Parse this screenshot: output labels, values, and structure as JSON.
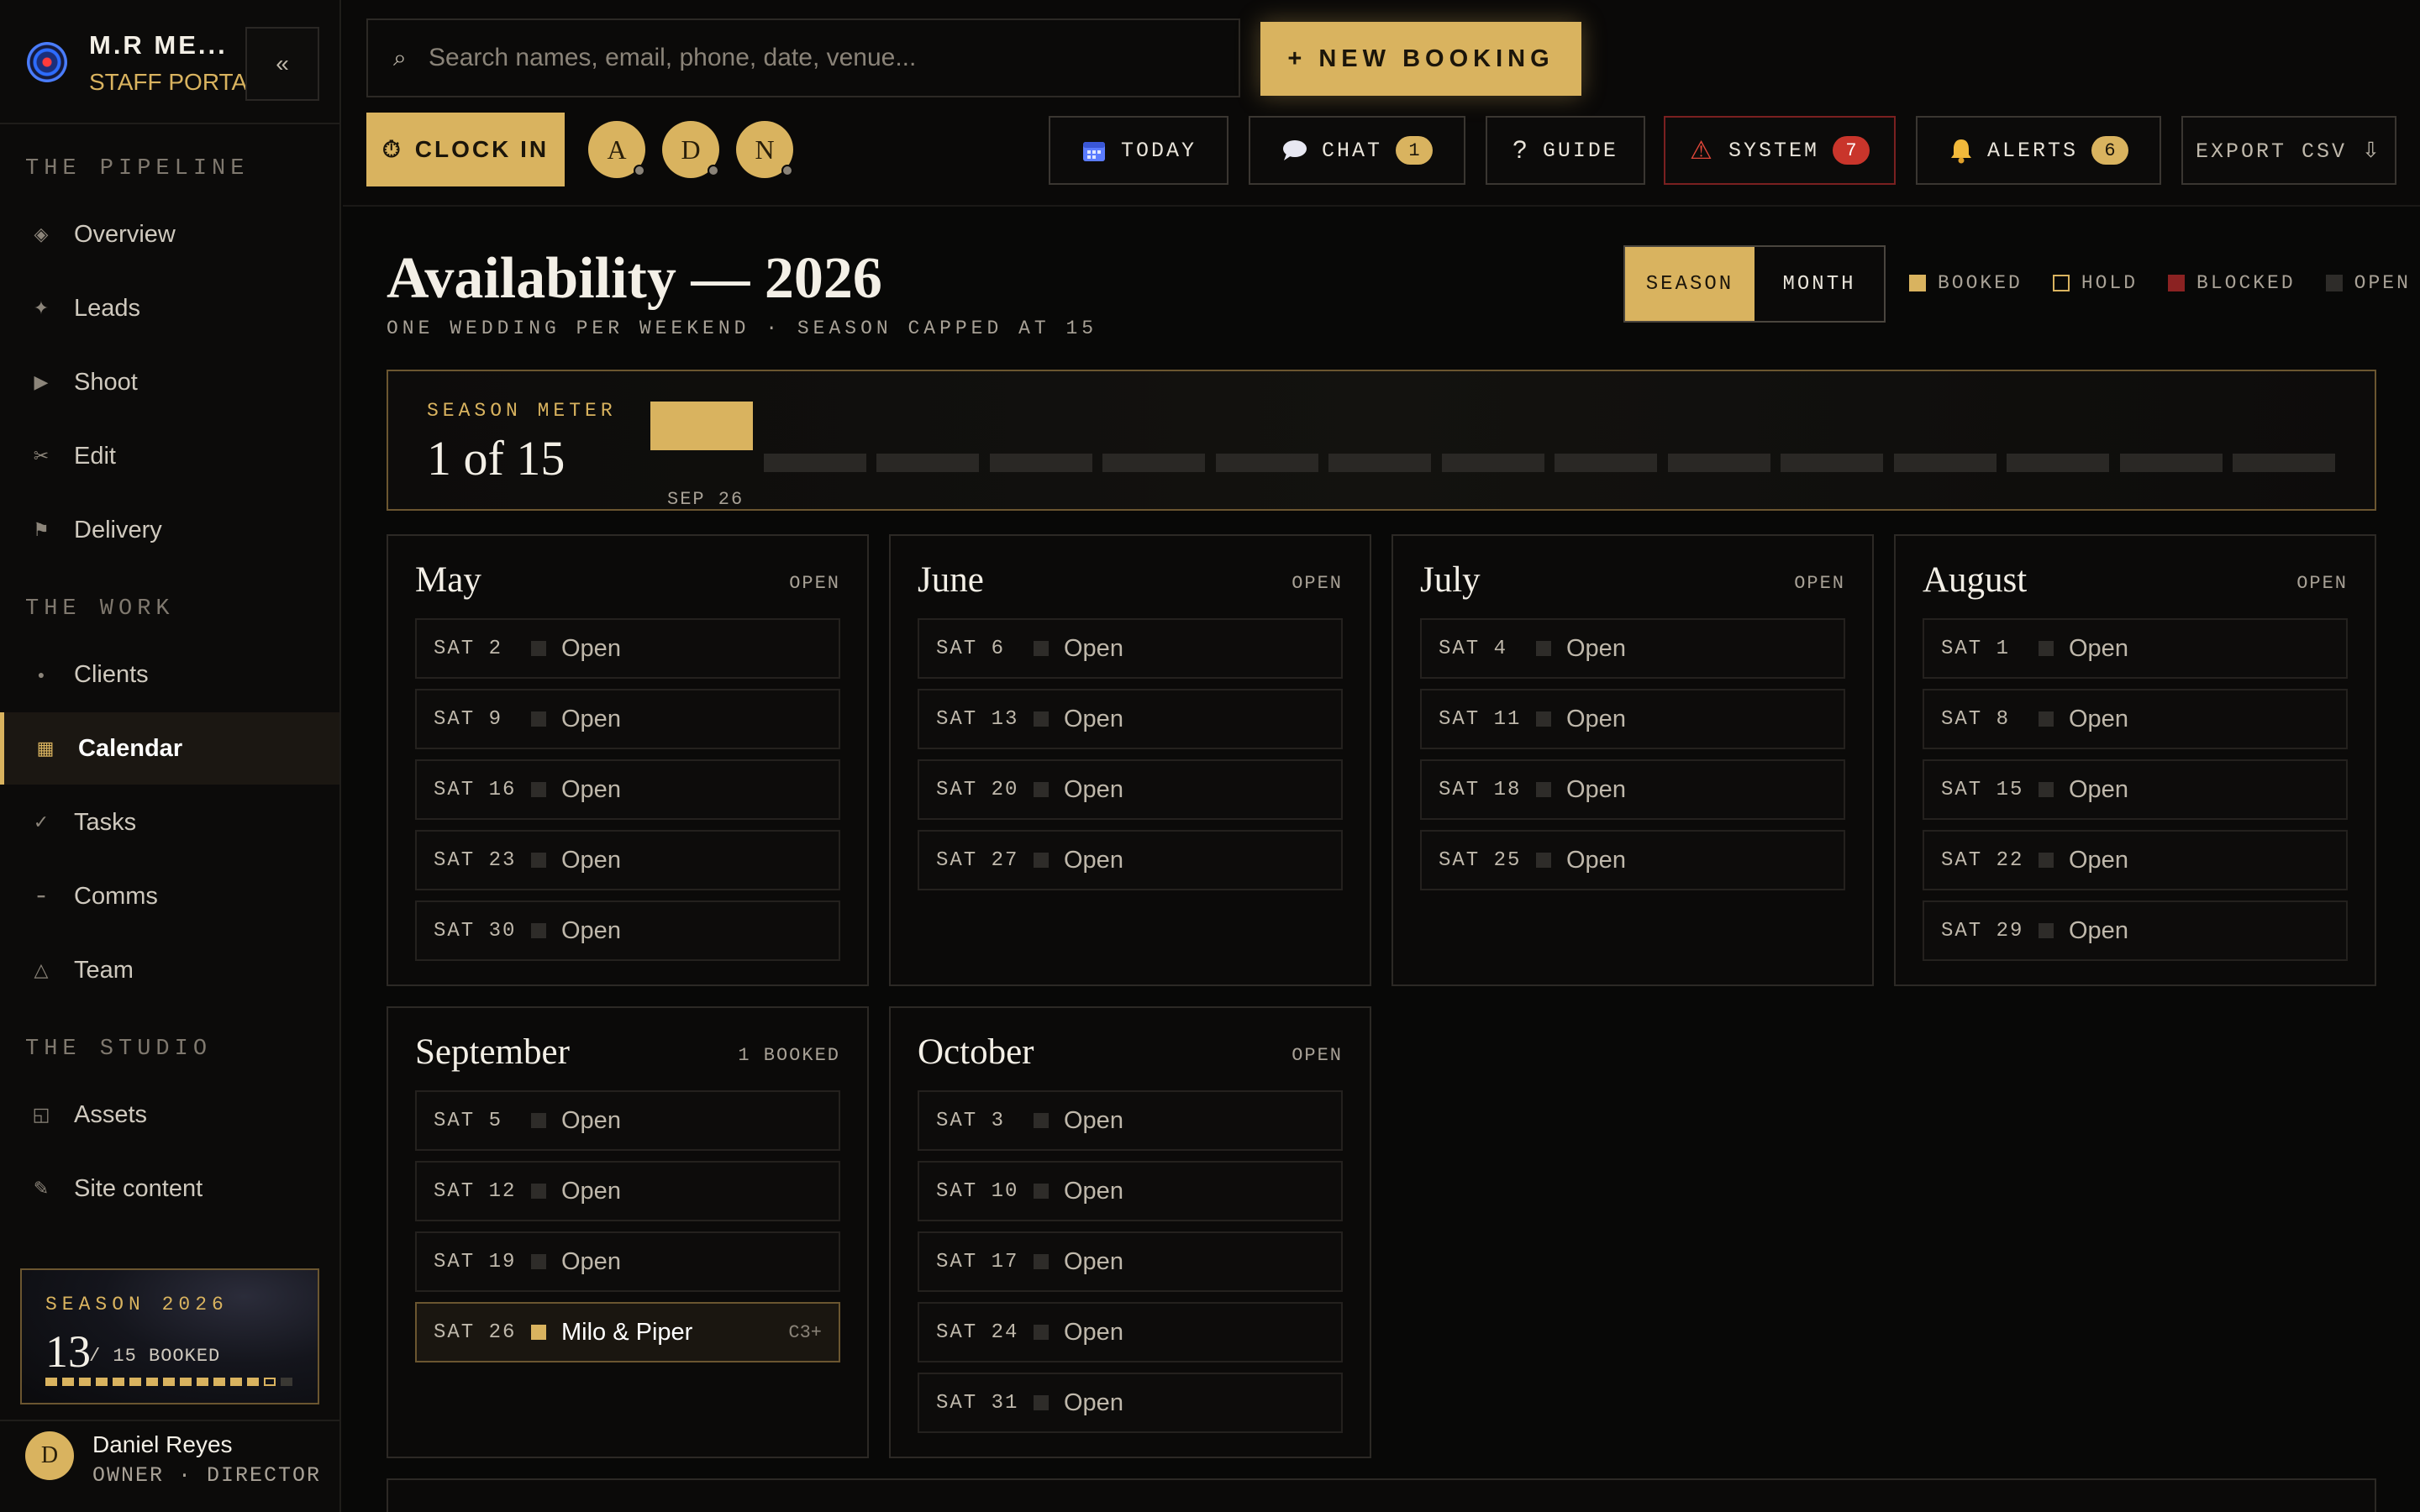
{
  "brand": {
    "name": "M.R ME...",
    "subtitle": "STAFF PORTAL",
    "collapse_label": "«"
  },
  "sidebar": {
    "sections": [
      {
        "title": "THE PIPELINE",
        "items": [
          {
            "label": "Overview",
            "icon": "diamond-icon",
            "glyph": "◈"
          },
          {
            "label": "Leads",
            "icon": "sparkle-icon",
            "glyph": "✦"
          },
          {
            "label": "Shoot",
            "icon": "play-icon",
            "glyph": "▶"
          },
          {
            "label": "Edit",
            "icon": "scissors-icon",
            "glyph": "✂"
          },
          {
            "label": "Delivery",
            "icon": "flag-icon",
            "glyph": "⚑"
          }
        ]
      },
      {
        "title": "THE WORK",
        "items": [
          {
            "label": "Clients",
            "icon": "dot-icon",
            "glyph": "●"
          },
          {
            "label": "Calendar",
            "icon": "calendar-icon",
            "glyph": "▦",
            "active": true
          },
          {
            "label": "Tasks",
            "icon": "check-icon",
            "glyph": "✓"
          },
          {
            "label": "Comms",
            "icon": "dash-icon",
            "glyph": "━"
          },
          {
            "label": "Team",
            "icon": "triangle-icon",
            "glyph": "△"
          }
        ]
      },
      {
        "title": "THE STUDIO",
        "items": [
          {
            "label": "Assets",
            "icon": "image-icon",
            "glyph": "◱"
          },
          {
            "label": "Site content",
            "icon": "pencil-icon",
            "glyph": "✎"
          }
        ]
      }
    ],
    "season_card": {
      "title": "SEASON 2026",
      "booked": "13",
      "total_label": "/ 15 BOOKED",
      "booked_fraction": 0.867,
      "pips_booked": 13,
      "pips_hold": 1,
      "pips_open": 1
    },
    "user": {
      "initial": "D",
      "name": "Daniel Reyes",
      "role": "OWNER · DIRECTOR"
    }
  },
  "topbar": {
    "search_placeholder": "Search names, email, phone, date, venue...",
    "search_icon": "⌕",
    "new_booking_label": "+ NEW BOOKING",
    "clock_in_label": "CLOCK IN",
    "clock_icon": "⏱",
    "team": [
      "A",
      "D",
      "N"
    ],
    "buttons": {
      "today": {
        "label": "TODAY",
        "icon": "calendar-icon"
      },
      "chat": {
        "label": "CHAT",
        "count": "1",
        "icon": "chat-bubble-icon"
      },
      "guide": {
        "label": "GUIDE",
        "glyph": "?"
      },
      "system": {
        "label": "SYSTEM",
        "count": "7",
        "glyph": "⚠"
      },
      "alerts": {
        "label": "ALERTS",
        "count": "6",
        "icon": "bell-icon"
      },
      "export": {
        "label": "EXPORT CSV ⇩"
      }
    }
  },
  "page": {
    "title": "Availability — 2026",
    "subtitle": "ONE WEDDING PER WEEKEND · SEASON CAPPED AT 15",
    "view_toggle": {
      "season": "SEASON",
      "month": "MONTH",
      "selected": "SEASON"
    },
    "legend": [
      {
        "label": "BOOKED",
        "color": "#d9b35f",
        "style": "fill"
      },
      {
        "label": "HOLD",
        "color": "#d9b35f",
        "style": "outline"
      },
      {
        "label": "BLOCKED",
        "color": "#8b2222",
        "style": "fill"
      },
      {
        "label": "OPEN",
        "color": "#2e2c29",
        "style": "fill"
      }
    ]
  },
  "season_meter": {
    "label": "SEASON METER",
    "value": "1 of 15",
    "booked": 1,
    "cap": 15,
    "first_label": "SEP 26"
  },
  "months": [
    {
      "name": "May",
      "status": "OPEN",
      "days": [
        {
          "date": "SAT 2",
          "state": "Open"
        },
        {
          "date": "SAT 9",
          "state": "Open"
        },
        {
          "date": "SAT 16",
          "state": "Open"
        },
        {
          "date": "SAT 23",
          "state": "Open"
        },
        {
          "date": "SAT 30",
          "state": "Open"
        }
      ]
    },
    {
      "name": "June",
      "status": "OPEN",
      "days": [
        {
          "date": "SAT 6",
          "state": "Open"
        },
        {
          "date": "SAT 13",
          "state": "Open"
        },
        {
          "date": "SAT 20",
          "state": "Open"
        },
        {
          "date": "SAT 27",
          "state": "Open"
        }
      ]
    },
    {
      "name": "July",
      "status": "OPEN",
      "days": [
        {
          "date": "SAT 4",
          "state": "Open"
        },
        {
          "date": "SAT 11",
          "state": "Open"
        },
        {
          "date": "SAT 18",
          "state": "Open"
        },
        {
          "date": "SAT 25",
          "state": "Open"
        }
      ]
    },
    {
      "name": "August",
      "status": "OPEN",
      "days": [
        {
          "date": "SAT 1",
          "state": "Open"
        },
        {
          "date": "SAT 8",
          "state": "Open"
        },
        {
          "date": "SAT 15",
          "state": "Open"
        },
        {
          "date": "SAT 22",
          "state": "Open"
        },
        {
          "date": "SAT 29",
          "state": "Open"
        }
      ]
    },
    {
      "name": "September",
      "status": "1 BOOKED",
      "days": [
        {
          "date": "SAT 5",
          "state": "Open"
        },
        {
          "date": "SAT 12",
          "state": "Open"
        },
        {
          "date": "SAT 19",
          "state": "Open"
        },
        {
          "date": "SAT 26",
          "state": "Milo & Piper",
          "booked": true,
          "tag": "C3+"
        }
      ]
    },
    {
      "name": "October",
      "status": "OPEN",
      "days": [
        {
          "date": "SAT 3",
          "state": "Open"
        },
        {
          "date": "SAT 10",
          "state": "Open"
        },
        {
          "date": "SAT 17",
          "state": "Open"
        },
        {
          "date": "SAT 24",
          "state": "Open"
        },
        {
          "date": "SAT 31",
          "state": "Open"
        }
      ]
    }
  ]
}
